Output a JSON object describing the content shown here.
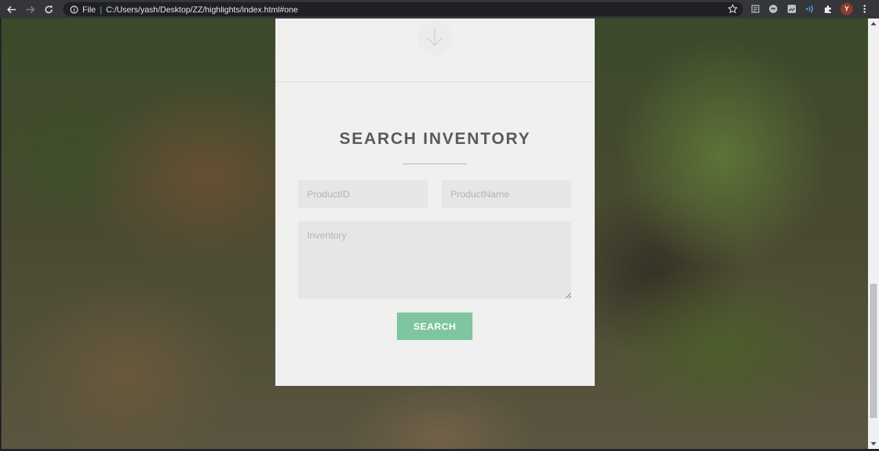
{
  "browser": {
    "file_label": "File",
    "url": "C:/Users/yash/Desktop/ZZ/highlights/index.html#one",
    "avatar_letter": "Y"
  },
  "page": {
    "title": "SEARCH INVENTORY",
    "fields": {
      "product_id_placeholder": "ProductID",
      "product_name_placeholder": "ProductName",
      "inventory_placeholder": "Inventory"
    },
    "search_button": "SEARCH"
  },
  "colors": {
    "accent_button": "#7ec5a0",
    "title_text": "#5a5a5a",
    "card_bg": "#f6f6f6"
  },
  "icons": [
    "back-icon",
    "forward-icon",
    "reload-icon",
    "info-icon",
    "star-icon",
    "reading-list-icon",
    "sync-icon",
    "image-ext-icon",
    "voice-ext-icon",
    "puzzle-icon",
    "menu-dots-icon",
    "arrow-down-icon"
  ]
}
